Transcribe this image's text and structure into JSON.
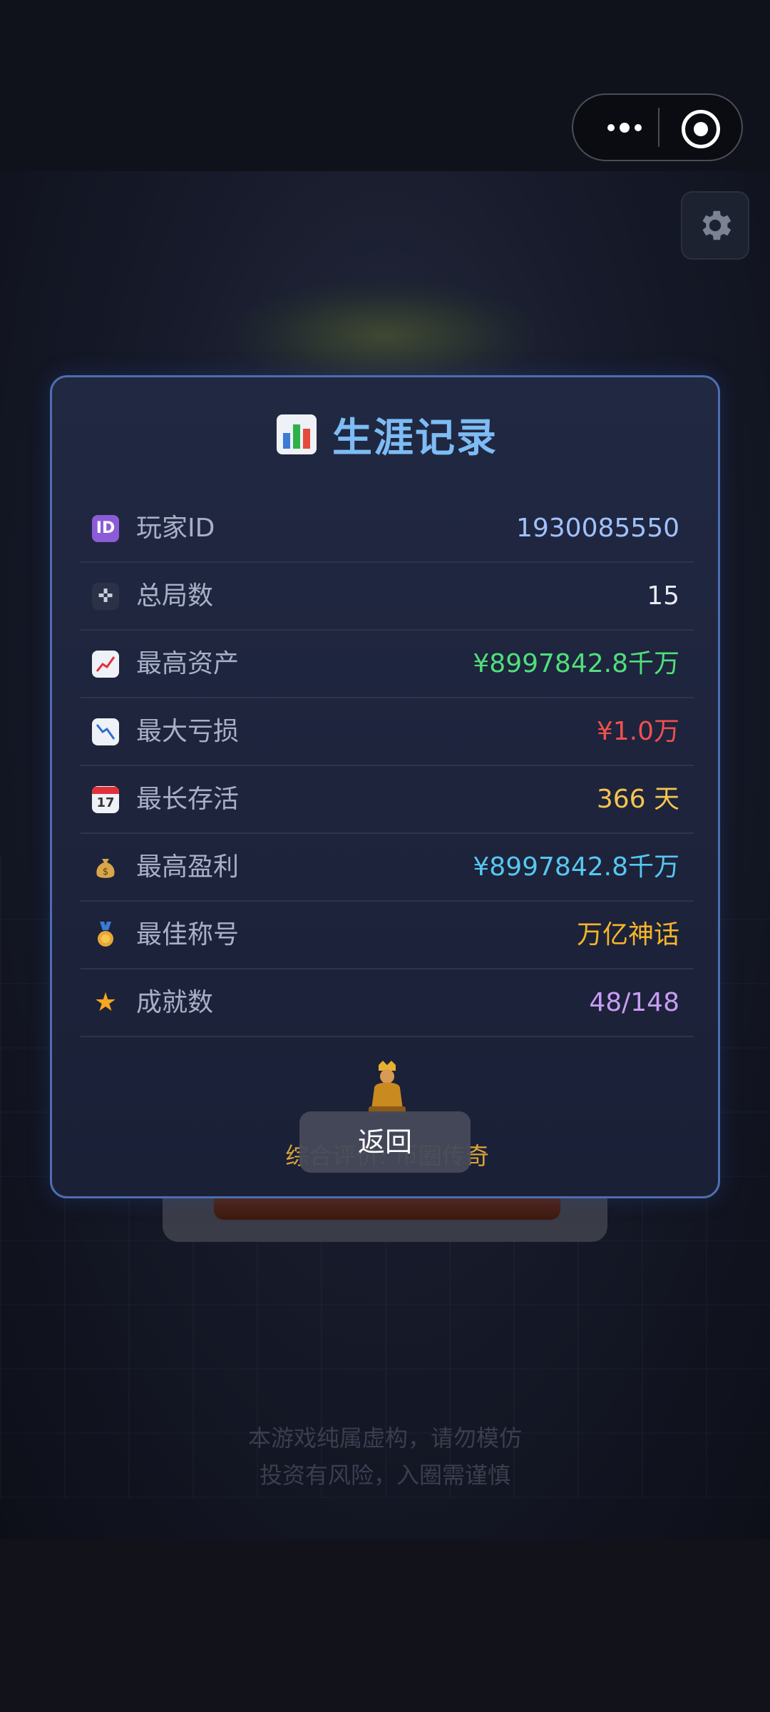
{
  "capsule": {
    "more_icon": "more-dots-icon",
    "close_icon": "target-circle-icon"
  },
  "background": {
    "disclaimer_line1": "本游戏纯属虚构，请勿模仿",
    "disclaimer_line2": "投资有风险，入圈需谨慎",
    "settings_icon": "gear-icon"
  },
  "modal": {
    "title": "生涯记录",
    "title_icon": "bar-chart-icon",
    "rows": [
      {
        "icon": "id-icon",
        "label": "玩家ID",
        "value": "1930085550",
        "color": "#9fc2ff"
      },
      {
        "icon": "gamepad-icon",
        "label": "总局数",
        "value": "15",
        "color": "#e6e9f2"
      },
      {
        "icon": "trend-up-icon",
        "label": "最高资产",
        "value": "¥8997842.8千万",
        "color": "#4fe07a"
      },
      {
        "icon": "trend-down-icon",
        "label": "最大亏损",
        "value": "¥1.0万",
        "color": "#f0504f"
      },
      {
        "icon": "calendar-icon",
        "label": "最长存活",
        "value": "366 天",
        "color": "#f5c550"
      },
      {
        "icon": "money-bag-icon",
        "label": "最高盈利",
        "value": "¥8997842.8千万",
        "color": "#56c8f0"
      },
      {
        "icon": "medal-icon",
        "label": "最佳称号",
        "value": "万亿神话",
        "color": "#f5b52a"
      },
      {
        "icon": "star-icon",
        "label": "成就数",
        "value": "48/148",
        "color": "#c89cf5"
      }
    ],
    "rating_text": "综合评价: 币圈传奇",
    "rating_icon": "king-figure-icon"
  },
  "toast": {
    "label": "返回"
  }
}
